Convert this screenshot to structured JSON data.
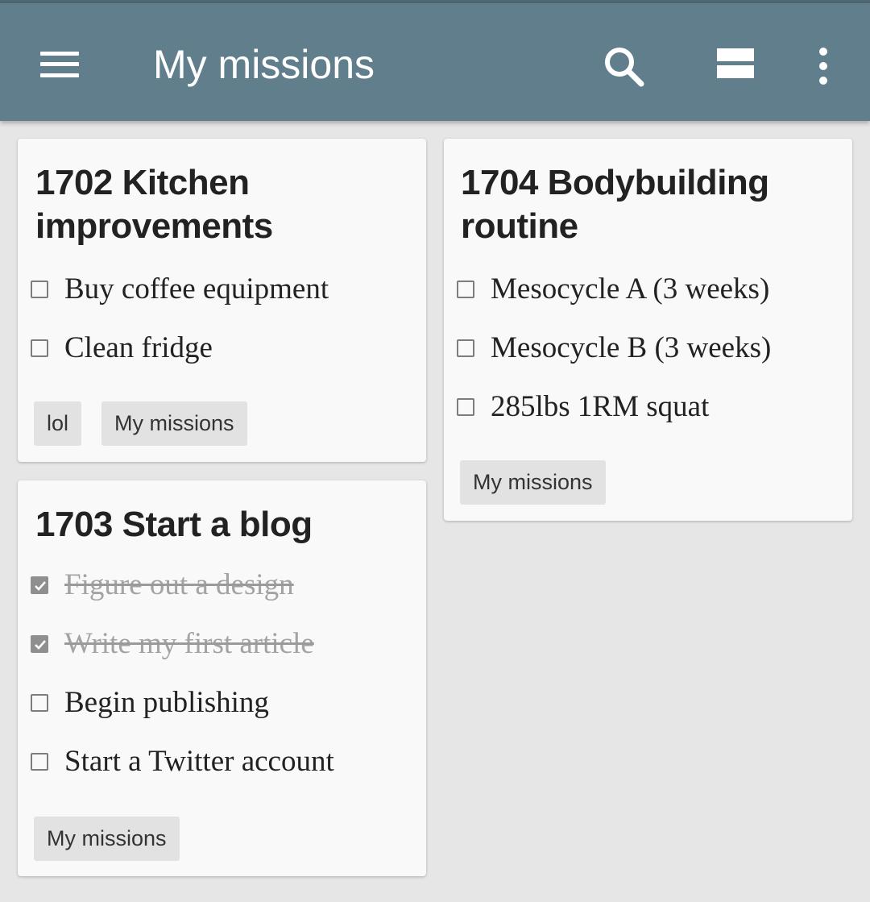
{
  "appbar": {
    "title": "My missions",
    "icons": [
      "menu-icon",
      "search-icon",
      "view-agenda-icon",
      "more-vert-icon"
    ],
    "color": "#617e8c"
  },
  "cards": [
    {
      "title_line1": "1702 Kitchen",
      "title_line2": "improvements",
      "items": [
        {
          "label": "Buy coffee equipment",
          "checked": false
        },
        {
          "label": "Clean fridge",
          "checked": false
        }
      ],
      "tags": [
        "lol",
        "My missions"
      ]
    },
    {
      "title_line1": "1703 Start a blog",
      "items": [
        {
          "label": "Figure out a design",
          "checked": true
        },
        {
          "label": "Write my first article",
          "checked": true
        },
        {
          "label": "Begin publishing",
          "checked": false
        },
        {
          "label": "Start a Twitter account",
          "checked": false
        }
      ],
      "tags": [
        "My missions"
      ]
    },
    {
      "title_line1": "1704 Bodybuilding",
      "title_line2": "routine",
      "items": [
        {
          "label": "Mesocycle A (3 weeks)",
          "checked": false
        },
        {
          "label": "Mesocycle B (3 weeks)",
          "checked": false
        },
        {
          "label": "285lbs 1RM squat",
          "checked": false
        }
      ],
      "tags": [
        "My missions"
      ]
    }
  ]
}
